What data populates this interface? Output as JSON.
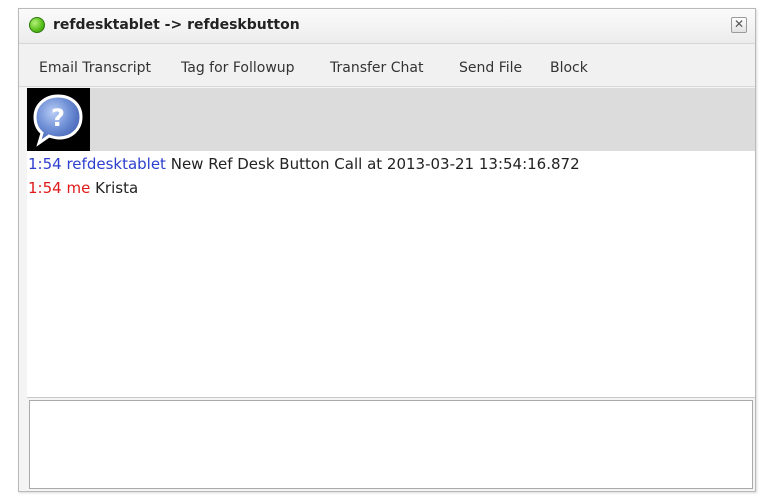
{
  "window": {
    "title": "refdesktablet -> refdeskbutton",
    "close_label": "✕",
    "status_color": "#4fbf1a"
  },
  "menu": {
    "items": [
      {
        "label": "Email Transcript"
      },
      {
        "label": "Tag for Followup"
      },
      {
        "label": "Transfer Chat"
      },
      {
        "label": "Send File"
      },
      {
        "label": "Block"
      }
    ]
  },
  "avatar": {
    "icon": "question-chat-bubble-icon",
    "glyph": "?"
  },
  "transcript": {
    "messages": [
      {
        "time": "1:54",
        "sender": "refdesktablet",
        "text": "New Ref Desk Button Call at 2013-03-21 13:54:16.872",
        "color": "#2d3fcf"
      },
      {
        "time": "1:54",
        "sender": "me",
        "text": "Krista",
        "color": "#e01a1a"
      }
    ]
  },
  "input": {
    "value": ""
  }
}
